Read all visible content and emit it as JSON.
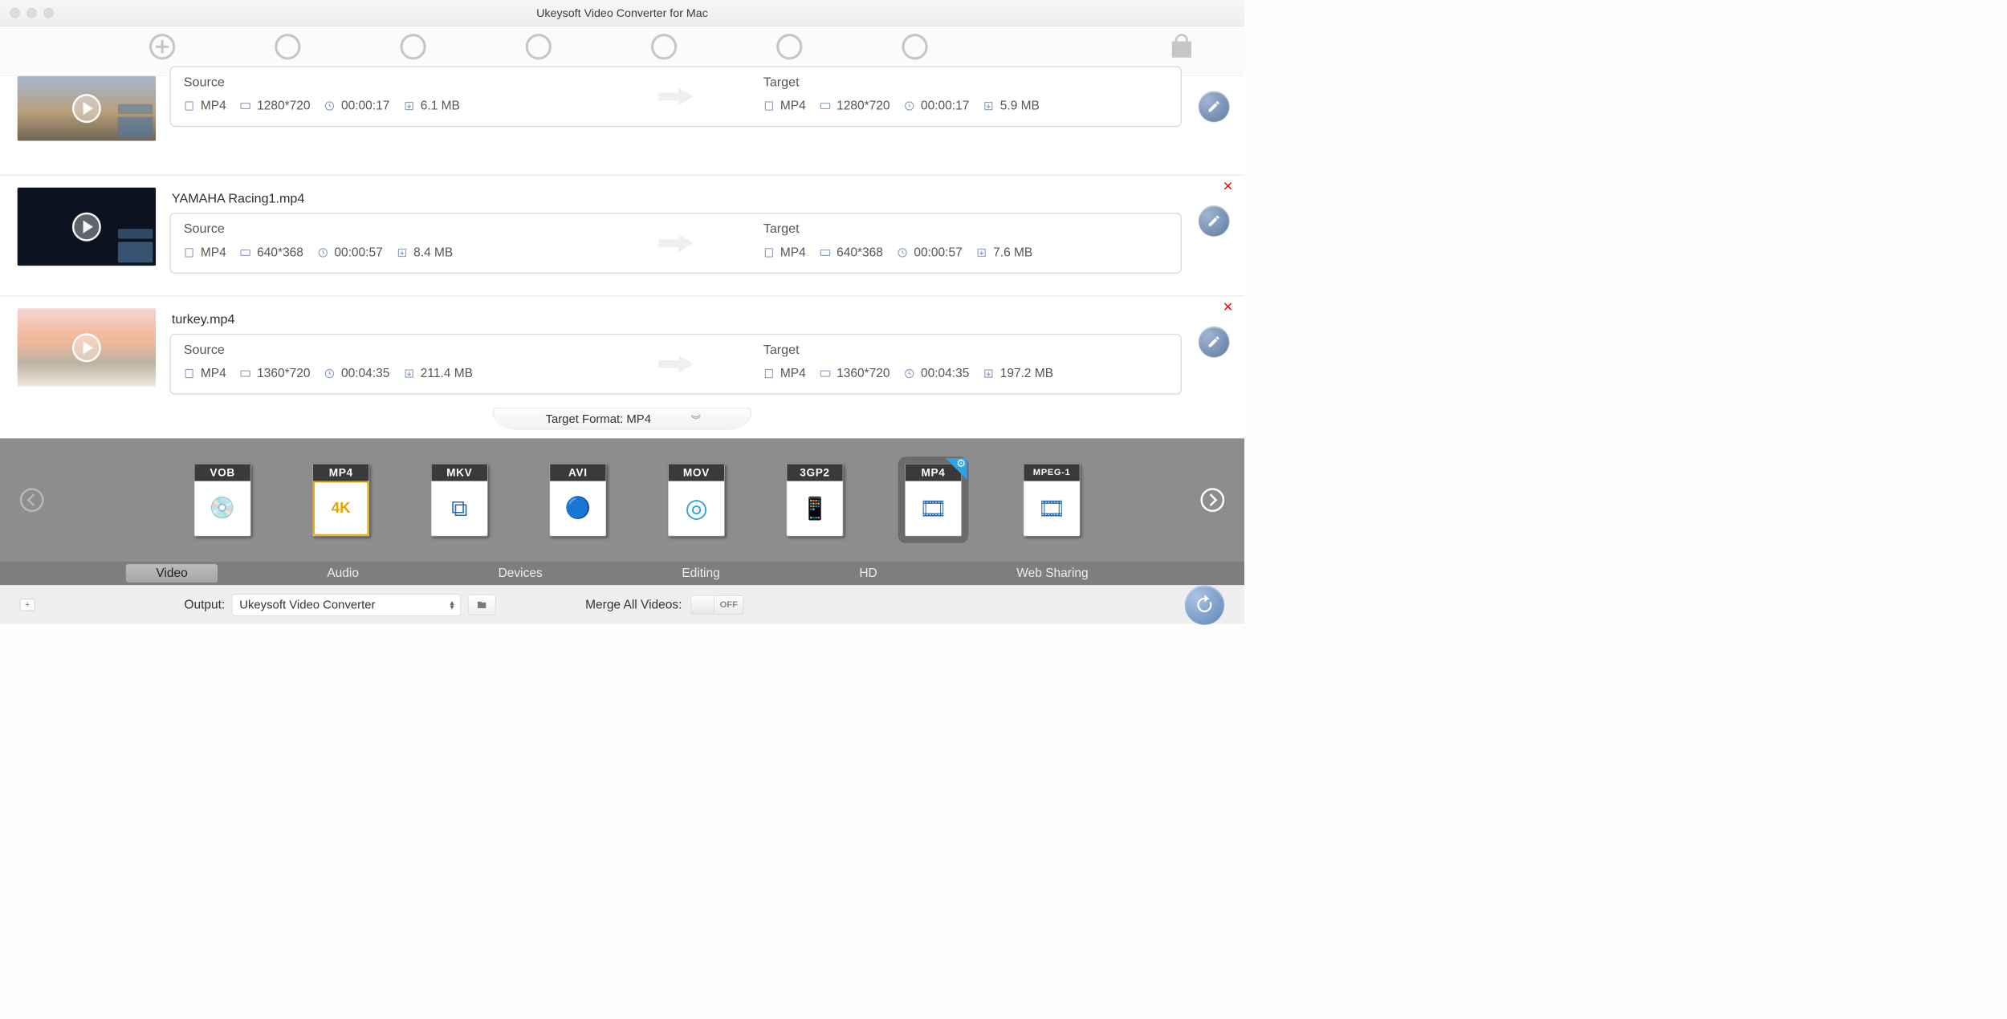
{
  "window": {
    "title": "Ukeysoft Video Converter for Mac"
  },
  "labels": {
    "source": "Source",
    "target": "Target"
  },
  "files": [
    {
      "name": "",
      "source": {
        "format": "MP4",
        "resolution": "1280*720",
        "duration": "00:00:17",
        "size": "6.1 MB"
      },
      "target": {
        "format": "MP4",
        "resolution": "1280*720",
        "duration": "00:00:17",
        "size": "5.9 MB"
      }
    },
    {
      "name": "YAMAHA Racing1.mp4",
      "source": {
        "format": "MP4",
        "resolution": "640*368",
        "duration": "00:00:57",
        "size": "8.4 MB"
      },
      "target": {
        "format": "MP4",
        "resolution": "640*368",
        "duration": "00:00:57",
        "size": "7.6 MB"
      }
    },
    {
      "name": "turkey.mp4",
      "source": {
        "format": "MP4",
        "resolution": "1360*720",
        "duration": "00:04:35",
        "size": "211.4 MB"
      },
      "target": {
        "format": "MP4",
        "resolution": "1360*720",
        "duration": "00:04:35",
        "size": "197.2 MB"
      }
    }
  ],
  "targetFormat": {
    "label": "Target Format: MP4"
  },
  "formats": [
    {
      "code": "VOB",
      "selected": false
    },
    {
      "code": "MP4",
      "sub": "4K",
      "selected": false
    },
    {
      "code": "MKV",
      "selected": false
    },
    {
      "code": "AVI",
      "selected": false
    },
    {
      "code": "MOV",
      "selected": false
    },
    {
      "code": "3GP2",
      "selected": false
    },
    {
      "code": "MP4",
      "selected": true
    },
    {
      "code": "MPEG-1",
      "selected": false
    }
  ],
  "tabs": [
    "Video",
    "Audio",
    "Devices",
    "Editing",
    "HD",
    "Web Sharing"
  ],
  "activeTab": "Video",
  "bottom": {
    "outputLabel": "Output:",
    "outputValue": "Ukeysoft Video Converter",
    "mergeLabel": "Merge All Videos:",
    "mergeState": "OFF"
  }
}
